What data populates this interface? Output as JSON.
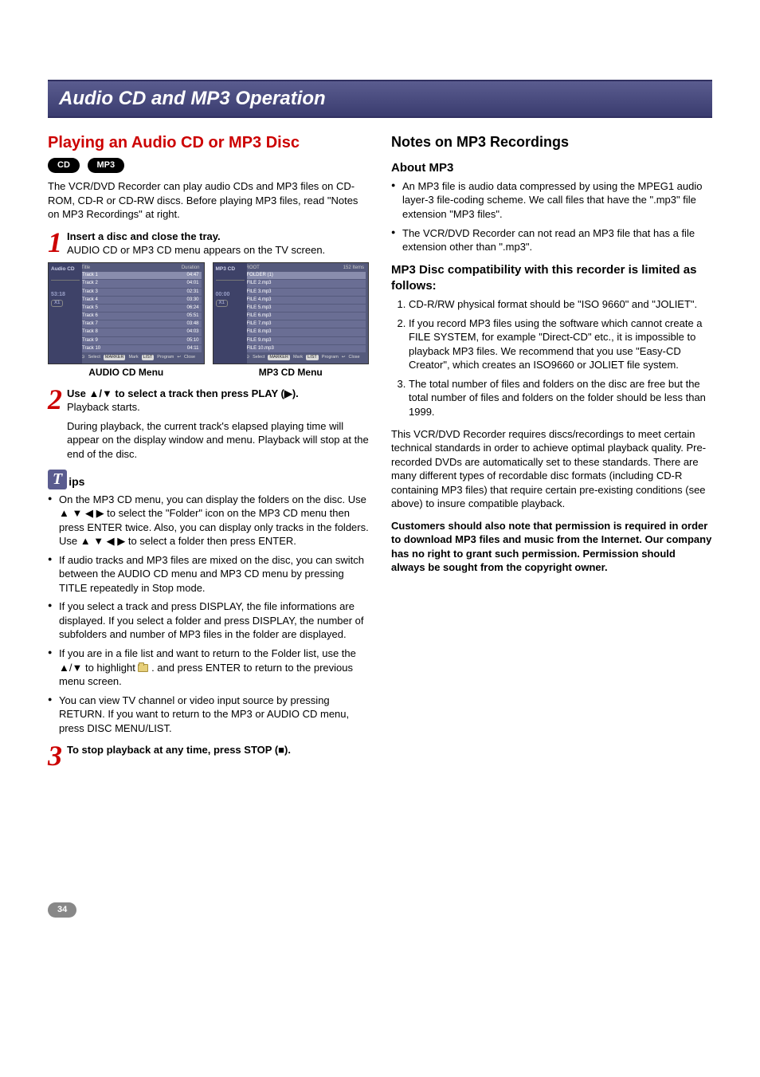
{
  "titleBar": "Audio CD and MP3 Operation",
  "left": {
    "heading": "Playing an Audio CD or MP3 Disc",
    "pills": [
      "CD",
      "MP3"
    ],
    "intro": "The VCR/DVD Recorder can play audio CDs and MP3 files on CD-ROM, CD-R or CD-RW discs. Before playing MP3 files, read \"Notes on MP3 Recordings\" at right.",
    "step1": {
      "num": "1",
      "lead": "Insert a disc and close the tray.",
      "body": "AUDIO CD or MP3 CD menu appears on the TV screen."
    },
    "audioMenu": {
      "sideLabel": "Audio CD",
      "sideTime": "53:18",
      "sideX": "X1",
      "colTitle": "Title",
      "colDur": "Duration",
      "rows": [
        {
          "t": "Track 1",
          "d": "04:47"
        },
        {
          "t": "Track 2",
          "d": "04:01"
        },
        {
          "t": "Track 3",
          "d": "02:31"
        },
        {
          "t": "Track 4",
          "d": "03:30"
        },
        {
          "t": "Track 5",
          "d": "06:24"
        },
        {
          "t": "Track 6",
          "d": "05:51"
        },
        {
          "t": "Track 7",
          "d": "03:48"
        },
        {
          "t": "Track 8",
          "d": "04:03"
        },
        {
          "t": "Track 9",
          "d": "05:10"
        },
        {
          "t": "Track 10",
          "d": "04:11"
        }
      ],
      "foot": {
        "select": "Select",
        "marker": "MARKER",
        "mark": "Mark",
        "list": "LIST",
        "program": "Program",
        "close": "Close"
      }
    },
    "mp3Menu": {
      "sideLabel": "MP3 CD",
      "sideTime": "00:00",
      "sideX": "X1",
      "root": "ROOT",
      "items": "152 Items",
      "rows": [
        "FOLDER (1)",
        "FILE 2.mp3",
        "FILE 3.mp3",
        "FILE 4.mp3",
        "FILE 5.mp3",
        "FILE 6.mp3",
        "FILE 7.mp3",
        "FILE 8.mp3",
        "FILE 9.mp3",
        "FILE 10.mp3"
      ],
      "foot": {
        "select": "Select",
        "marker": "MARKER",
        "mark": "Mark",
        "list": "LIST",
        "program": "Program",
        "close": "Close"
      }
    },
    "caption1": "AUDIO CD Menu",
    "caption2": "MP3 CD Menu",
    "step2": {
      "num": "2",
      "lead": "Use ▲/▼ to select a track then press PLAY (▶).",
      "body": "Playback starts.",
      "extra": "During playback, the current track's elapsed playing time will appear on the display window and menu. Playback will stop at the end of the disc."
    },
    "tipsLabel": "ips",
    "tips": [
      "On the MP3 CD menu, you can display the folders on the disc. Use ▲ ▼ ◀ ▶ to select the \"Folder\" icon on the MP3 CD menu then press ENTER twice. Also, you can display only tracks in the folders. Use ▲ ▼ ◀ ▶ to select a folder then press ENTER.",
      "If audio tracks and MP3 files are mixed on the disc, you can switch between the AUDIO CD menu and MP3 CD menu by pressing TITLE repeatedly in Stop mode.",
      "If you select a track and press DISPLAY, the file informations are displayed. If you select a folder and press DISPLAY, the number of subfolders and number of MP3 files in the folder are displayed.",
      "If you are in a file list and want to return to the Folder list, use the ▲/▼ to highlight  and press ENTER to return to the previous menu screen.",
      "You can view TV channel or video input source by pressing RETURN. If you want to return to the MP3 or AUDIO CD menu, press DISC MENU/LIST."
    ],
    "tip4_pre": "If you are in a file list and want to return to the Folder list, use the ▲/▼ to highlight ",
    "tip4_post": " . and press ENTER to return to the previous menu screen.",
    "step3": {
      "num": "3",
      "lead": "To stop playback at any time, press STOP (■)."
    }
  },
  "right": {
    "heading": "Notes on MP3 Recordings",
    "sub1": "About MP3",
    "about": [
      "An MP3 file is audio data compressed by using the MPEG1 audio layer-3 file-coding scheme. We call files that have the \".mp3\" file extension \"MP3 files\".",
      "The VCR/DVD Recorder can not read an MP3 file that has a file extension other than \".mp3\"."
    ],
    "sub2": "MP3 Disc compatibility with this recorder is limited as follows:",
    "numbered": [
      "CD-R/RW physical format should be \"ISO 9660\" and \"JOLIET\".",
      "If you record MP3 files using the software which cannot create a FILE SYSTEM, for example \"Direct-CD\" etc., it is impossible to playback MP3 files. We recommend that you use \"Easy-CD Creator\", which creates an ISO9660 or JOLIET file system.",
      "The total number of files and folders on the disc are free but the total number of files and folders on the folder should be less than 1999."
    ],
    "para": "This VCR/DVD Recorder requires discs/recordings to meet certain technical standards in order to achieve optimal playback quality. Pre-recorded DVDs are automatically set to these standards. There are many different types of recordable disc formats (including CD-R containing MP3 files) that require certain pre-existing conditions (see above) to insure compatible playback.",
    "boldPara": "Customers should also note that permission is required in order to download MP3 files and music from the Internet. Our company has no right to grant such permission. Permission should always be sought from the copyright owner."
  },
  "pageNumber": "34"
}
